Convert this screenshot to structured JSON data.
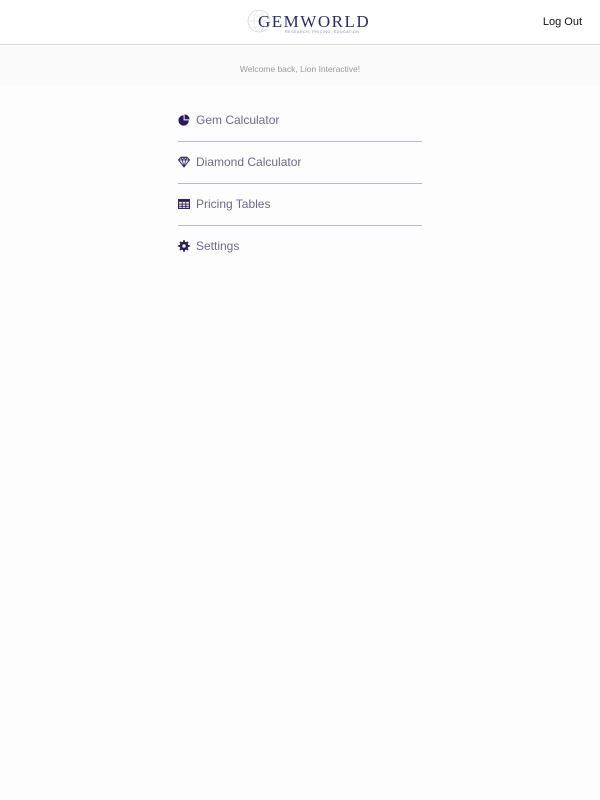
{
  "header": {
    "logo_text": "GEMWORLD",
    "logo_tagline": "RESEARCH, PRICING, EDUCATION",
    "logout_label": "Log Out"
  },
  "welcome": {
    "message": "Welcome back, Lion Interactive!"
  },
  "menu": {
    "items": [
      {
        "label": "Gem Calculator",
        "icon": "pie-chart-icon"
      },
      {
        "label": "Diamond Calculator",
        "icon": "diamond-icon"
      },
      {
        "label": "Pricing Tables",
        "icon": "table-icon"
      },
      {
        "label": "Settings",
        "icon": "gear-icon"
      }
    ]
  },
  "colors": {
    "brand": "#2b2a6b",
    "icon": "#2b1a5a",
    "label": "#6b6b8a",
    "divider": "#b9b9cc"
  }
}
